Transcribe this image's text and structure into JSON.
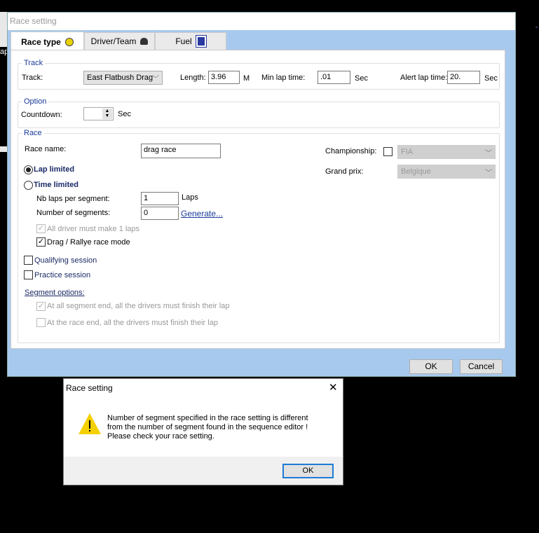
{
  "background_window": {
    "fragment_text": "ap"
  },
  "main_dialog": {
    "title": "Race setting",
    "tabs": [
      {
        "label": "Race type",
        "icon": "clock-face-icon",
        "active": true
      },
      {
        "label": "Driver/Team",
        "icon": "driver-helmet-icon"
      },
      {
        "label": "Fuel",
        "icon": "fuel-pump-icon"
      }
    ],
    "track": {
      "legend": "Track",
      "track_label": "Track:",
      "track_value": "East Flatbush  Drag",
      "length_label": "Length:",
      "length_value": "3.96",
      "length_unit": "M",
      "min_lap_label": "Min lap time:",
      "min_lap_value": ".01",
      "min_lap_unit": "Sec",
      "alert_lap_label": "Alert lap time:",
      "alert_lap_value": "20.",
      "alert_lap_unit": "Sec"
    },
    "option": {
      "legend": "Option",
      "countdown_label": "Countdown:",
      "countdown_value": "",
      "countdown_unit": "Sec"
    },
    "race": {
      "legend": "Race",
      "race_name_label": "Race name:",
      "race_name_value": "drag race",
      "lap_limited": "Lap limited",
      "time_limited": "Time limited",
      "selected_mode": "Lap limited",
      "nb_laps_label": "Nb laps per segment:",
      "nb_laps_value": "1",
      "nb_laps_unit": "Laps",
      "segments_label": "Number of segments:",
      "segments_value": "0",
      "generate_link": "Generate...",
      "all_driver_label": "All driver must make 1 laps",
      "all_driver_checked": true,
      "drag_mode_label": "Drag / Rallye race mode",
      "drag_mode_checked": true,
      "qualifying_label": "Qualifying session",
      "qualifying_checked": false,
      "practice_label": "Practice session",
      "practice_checked": false,
      "segment_options_label": "Segment options:",
      "seg_end_label": "At all segment end, all the drivers must finish their lap",
      "seg_end_checked": true,
      "race_end_label": "At the race end, all the drivers must finish their lap",
      "race_end_checked": false,
      "championship_label": "Championship:",
      "championship_checked": false,
      "championship_value": "FIA",
      "grand_prix_label": "Grand prix:",
      "grand_prix_value": "Belgique"
    },
    "ok_label": "OK",
    "cancel_label": "Cancel"
  },
  "message_box": {
    "title": "Race setting",
    "close": "✕",
    "icon": "warning-icon",
    "message_lines": [
      "Number of segment specified in the race setting is different",
      "from the number of segment found in the sequence editor !",
      "Please check your race setting."
    ],
    "ok_label": "OK"
  },
  "colors": {
    "dialog_frame": "#a8c9ee",
    "legend": "#1a3a9a",
    "link": "#1a3a9a",
    "warning": "#f5d000"
  }
}
